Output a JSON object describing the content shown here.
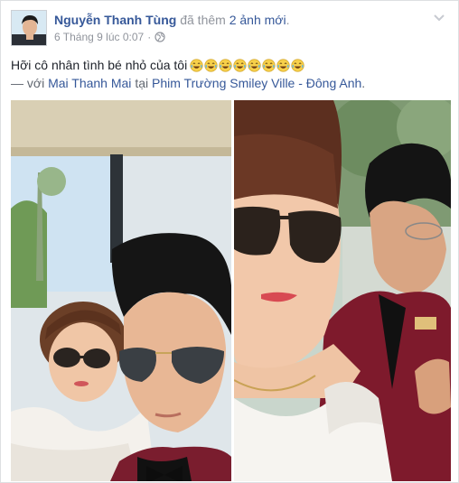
{
  "post": {
    "author_name": "Nguyễn Thanh Tùng",
    "action_prefix": "đã thêm",
    "action_count": "2 ảnh mới",
    "action_suffix": ".",
    "timestamp": "6 Tháng 9 lúc 0:07",
    "separator": "·",
    "privacy_icon": "globe-icon",
    "text": "Hỡi cô nhân tình bé nhỏ của tôi",
    "emoji_icon": "laughing-tears-emoji",
    "emoji_count": 8,
    "tag_prefix": "— với",
    "tagged_person": "Mai Thanh Mai",
    "tag_at": "tại",
    "location": "Phim Trường Smiley Ville - Đông Anh",
    "tag_suffix": ".",
    "photos": [
      "couple-selfie-left",
      "couple-selfie-right"
    ]
  },
  "colors": {
    "link": "#365899",
    "meta": "#90949c",
    "text": "#1d2129",
    "border": "#dddfe2"
  }
}
